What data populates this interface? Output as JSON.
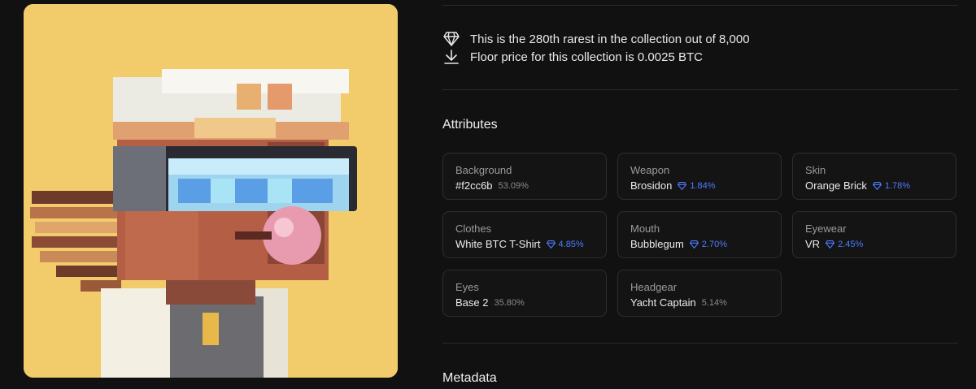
{
  "nft": {
    "image_alt": "Pixel-art character with white yacht captain hat, blue VR goggles, bubblegum and white BTC t-shirt on yellow background"
  },
  "info": {
    "rarity_icon": "diamond-icon",
    "rarity_text": "This is the 280th rarest in the collection out of 8,000",
    "floor_icon": "download-arrow-icon",
    "floor_text": "Floor price for this collection is 0.0025 BTC"
  },
  "attributes": {
    "title": "Attributes",
    "items": [
      {
        "type": "Background",
        "value": "#f2cc6b",
        "percent": "53.09%",
        "rare": false
      },
      {
        "type": "Weapon",
        "value": "Brosidon",
        "percent": "1.84%",
        "rare": true
      },
      {
        "type": "Skin",
        "value": "Orange Brick",
        "percent": "1.78%",
        "rare": true
      },
      {
        "type": "Clothes",
        "value": "White BTC T-Shirt",
        "percent": "4.85%",
        "rare": true
      },
      {
        "type": "Mouth",
        "value": "Bubblegum",
        "percent": "2.70%",
        "rare": true
      },
      {
        "type": "Eyewear",
        "value": "VR",
        "percent": "2.45%",
        "rare": true
      },
      {
        "type": "Eyes",
        "value": "Base 2",
        "percent": "35.80%",
        "rare": false
      },
      {
        "type": "Headgear",
        "value": "Yacht Captain",
        "percent": "5.14%",
        "rare": false
      }
    ]
  },
  "metadata": {
    "title": "Metadata"
  },
  "colors": {
    "background": "#111111",
    "rare_accent": "#4e7bff",
    "art_background": "#f2cc6b"
  }
}
